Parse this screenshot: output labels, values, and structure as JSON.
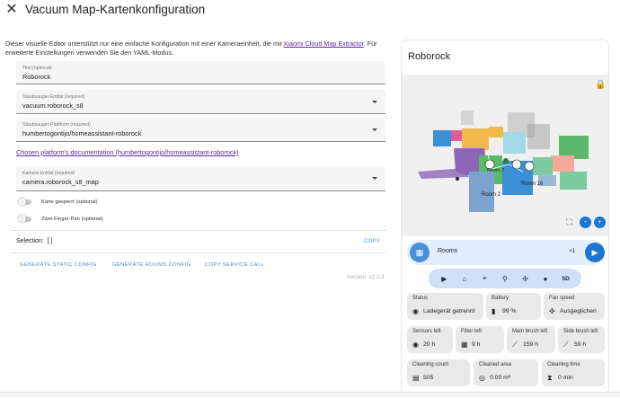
{
  "dialog": {
    "close_glyph": "✕",
    "title": "Vacuum Map-Kartenkonfiguration"
  },
  "intro": {
    "text_before": "Dieser visuelle Editor unterstützt nur eine einfache Konfiguration mit einer Kameraeinheit, die mit ",
    "link": "Xiaomi Cloud Map Extractor",
    "text_after": ". Für erweiterte Einstellungen verwenden Sie den YAML-Modus."
  },
  "form": {
    "title_field": {
      "label": "Titel (optional)",
      "value": "Roborock"
    },
    "vacuum_field": {
      "label": "Staubsauger Entität (required)",
      "value": "vacuum.roborock_s8"
    },
    "platform_field": {
      "label": "Staubsauger-Plattform (required)",
      "value": "humbertogontijo/homeassistant-roborock"
    },
    "doc_link": "Chosen platform's documentation (humbertogontijo/homeassistant-roborock)",
    "camera_field": {
      "label": "Kamera Entität (required)",
      "value": "camera.roborock_s8_map"
    },
    "toggle_locked": "Karte gesperrt (optional)",
    "toggle_twofinger": "Zwei-Finger-Pan (optional)",
    "selection_label": "Selection:",
    "selection_value": "[ ]",
    "copy_label": "COPY",
    "gen_static": "GENERATE STATIC CONFIG",
    "gen_rooms": "GENERATE ROOMS CONFIG",
    "copy_service": "COPY SERVICE CALL",
    "version": "Version: v2.2.2"
  },
  "card": {
    "title": "Roborock",
    "lock_icon": "lock-icon",
    "rooms": {
      "label_room2": "Room 2",
      "label_room16": "Room 16",
      "label_room_overlay": "Room 7"
    },
    "mode_label": "Rooms",
    "repeat_label": "×1",
    "actions": [
      "play-icon",
      "home-icon",
      "target-icon",
      "pin-icon",
      "fan-icon",
      "water-icon",
      "5D"
    ],
    "tiles_row1": [
      {
        "label": "Status",
        "icon": "◉",
        "value": "Ladegerät getrennt"
      },
      {
        "label": "Battery",
        "icon": "▮",
        "value": "99 %"
      },
      {
        "label": "Fan speed",
        "icon": "✣",
        "value": "Ausgeglichen"
      }
    ],
    "tiles_row2": [
      {
        "label": "Sensors left",
        "icon": "◉",
        "value": "20 h"
      },
      {
        "label": "Filter left",
        "icon": "▦",
        "value": "9 h"
      },
      {
        "label": "Main brush left",
        "icon": "⟋",
        "value": "159 h"
      },
      {
        "label": "Side brush left",
        "icon": "⟋",
        "value": "59 h"
      }
    ],
    "tiles_row3": [
      {
        "label": "Cleaning count",
        "icon": "▤",
        "value": "505"
      },
      {
        "label": "Cleaned area",
        "icon": "◎",
        "value": "0.00 m²"
      },
      {
        "label": "Cleaning time",
        "icon": "⧗",
        "value": "0 min"
      }
    ]
  },
  "colors": {
    "accent": "#3f8fe0",
    "link": "#5b2a9b",
    "primary_button": "#1976d2"
  }
}
